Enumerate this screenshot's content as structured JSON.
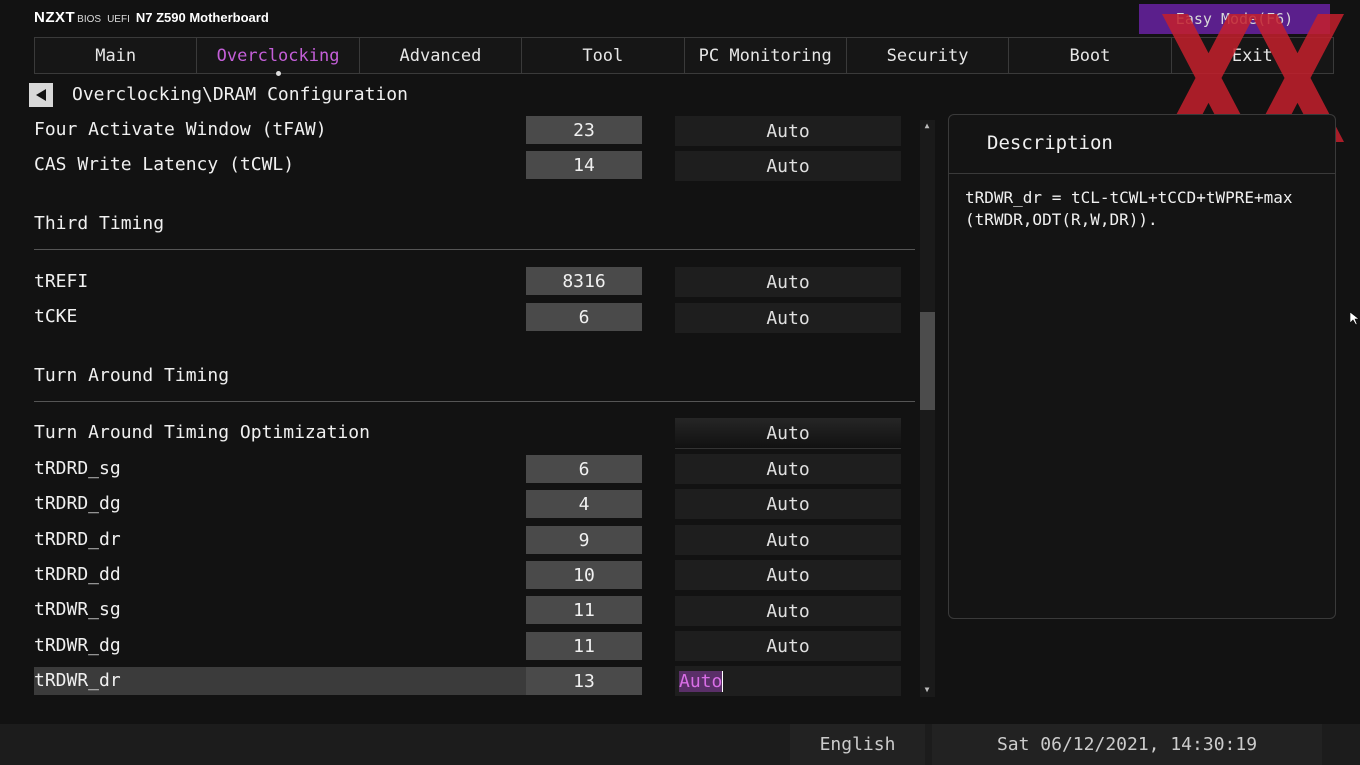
{
  "brand": {
    "logo": "NZXT",
    "bios": "BIOS",
    "uefi": "UEFI",
    "model": "N7 Z590 Motherboard"
  },
  "easy_mode_label": "Easy Mode(F6)",
  "tabs": [
    {
      "label": "Main"
    },
    {
      "label": "Overclocking",
      "active": true
    },
    {
      "label": "Advanced"
    },
    {
      "label": "Tool"
    },
    {
      "label": "PC Monitoring"
    },
    {
      "label": "Security"
    },
    {
      "label": "Boot"
    },
    {
      "label": "Exit"
    }
  ],
  "breadcrumb": "Overclocking\\DRAM Configuration",
  "rows": {
    "tfaw": {
      "label": "Four Activate Window (tFAW)",
      "value": "23",
      "mode": "Auto"
    },
    "tcwl": {
      "label": "CAS Write Latency (tCWL)",
      "value": "14",
      "mode": "Auto"
    },
    "third_timing": "Third Timing",
    "trefi": {
      "label": "tREFI",
      "value": "8316",
      "mode": "Auto"
    },
    "tcke": {
      "label": "tCKE",
      "value": "6",
      "mode": "Auto"
    },
    "turn_around_timing": "Turn Around Timing",
    "tat_opt": {
      "label": "Turn Around Timing Optimization",
      "mode": "Auto"
    },
    "trdrd_sg": {
      "label": "tRDRD_sg",
      "value": "6",
      "mode": "Auto"
    },
    "trdrd_dg": {
      "label": "tRDRD_dg",
      "value": "4",
      "mode": "Auto"
    },
    "trdrd_dr": {
      "label": "tRDRD_dr",
      "value": "9",
      "mode": "Auto"
    },
    "trdrd_dd": {
      "label": "tRDRD_dd",
      "value": "10",
      "mode": "Auto"
    },
    "trdwr_sg": {
      "label": "tRDWR_sg",
      "value": "11",
      "mode": "Auto"
    },
    "trdwr_dg": {
      "label": "tRDWR_dg",
      "value": "11",
      "mode": "Auto"
    },
    "trdwr_dr": {
      "label": "tRDWR_dr",
      "value": "13",
      "mode": "Auto"
    }
  },
  "description": {
    "title": "Description",
    "text": "tRDWR_dr = tCL-tCWL+tCCD+tWPRE+max(tRWDR,ODT(R,W,DR))."
  },
  "footer": {
    "language": "English",
    "datetime": "Sat 06/12/2021, 14:30:19"
  },
  "colors": {
    "accent": "#c45fd8",
    "easy_mode_bg": "#5b1f8c",
    "background": "#121212"
  },
  "watermark": "red-xx-logo"
}
